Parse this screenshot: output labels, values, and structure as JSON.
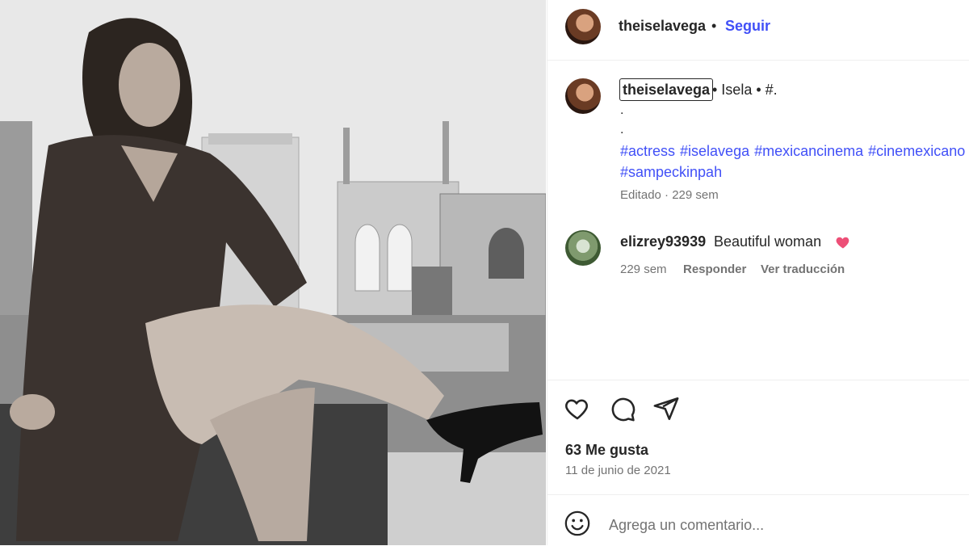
{
  "post": {
    "image": {
      "description_icon": "photo"
    },
    "header": {
      "username": "theiselavega",
      "separator": "•",
      "follow_label": "Seguir"
    },
    "caption": {
      "username": "theiselavega",
      "text": "• Isela • #.",
      "line2": ".",
      "line3": ".",
      "hashtags": [
        "#actress",
        "#iselavega",
        "#mexicancinema",
        "#cinemexicano",
        "#sampeckinpah"
      ],
      "meta": "Editado · 229 sem"
    },
    "comments": [
      {
        "username": "elizrey93939",
        "text": "Beautiful woman",
        "emoji": "pink-heart",
        "age": "229 sem",
        "reply_label": "Responder",
        "translate_label": "Ver traducción"
      }
    ],
    "likes": "63 Me gusta",
    "date": "11 de junio de 2021",
    "add_comment": {
      "placeholder": "Agrega un comentario..."
    }
  },
  "colors": {
    "link": "#4150f7",
    "muted": "#737373",
    "text": "#262626",
    "heart": "#ed4f77"
  }
}
